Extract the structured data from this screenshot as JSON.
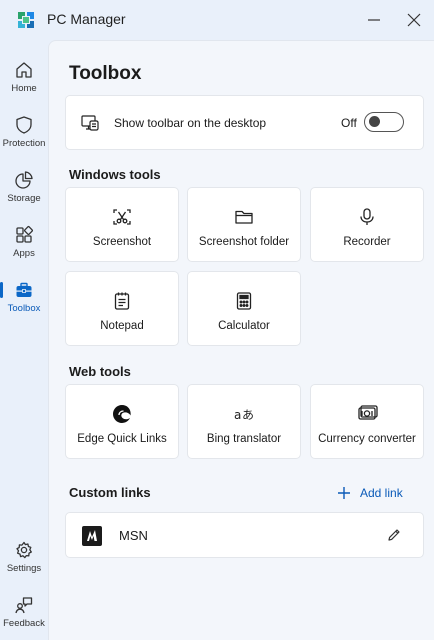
{
  "window": {
    "title": "PC Manager"
  },
  "sidebar": {
    "items": [
      {
        "label": "Home",
        "icon": "home-icon"
      },
      {
        "label": "Protection",
        "icon": "shield-icon"
      },
      {
        "label": "Storage",
        "icon": "pie-chart-icon"
      },
      {
        "label": "Apps",
        "icon": "apps-icon"
      },
      {
        "label": "Toolbox",
        "icon": "toolbox-icon",
        "active": true
      }
    ],
    "bottom_items": [
      {
        "label": "Settings",
        "icon": "gear-icon"
      },
      {
        "label": "Feedback",
        "icon": "feedback-icon"
      }
    ]
  },
  "main": {
    "title": "Toolbox",
    "toolbar_setting": {
      "label": "Show toolbar on the desktop",
      "state": "Off",
      "enabled": false
    },
    "windows_tools": {
      "title": "Windows tools",
      "tools": [
        {
          "label": "Screenshot",
          "icon": "screenshot-icon"
        },
        {
          "label": "Screenshot folder",
          "icon": "folder-icon"
        },
        {
          "label": "Recorder",
          "icon": "microphone-icon"
        },
        {
          "label": "Notepad",
          "icon": "notepad-icon"
        },
        {
          "label": "Calculator",
          "icon": "calculator-icon"
        }
      ]
    },
    "web_tools": {
      "title": "Web tools",
      "tools": [
        {
          "label": "Edge Quick Links",
          "icon": "edge-icon"
        },
        {
          "label": "Bing translator",
          "icon": "translate-icon"
        },
        {
          "label": "Currency converter",
          "icon": "currency-icon"
        }
      ]
    },
    "custom_links": {
      "title": "Custom links",
      "add_label": "Add link",
      "links": [
        {
          "label": "MSN",
          "icon": "msn-logo"
        }
      ]
    }
  },
  "colors": {
    "accent": "#0a5ab8",
    "background": "#e9f0fa",
    "content": "#f3f6fb"
  }
}
